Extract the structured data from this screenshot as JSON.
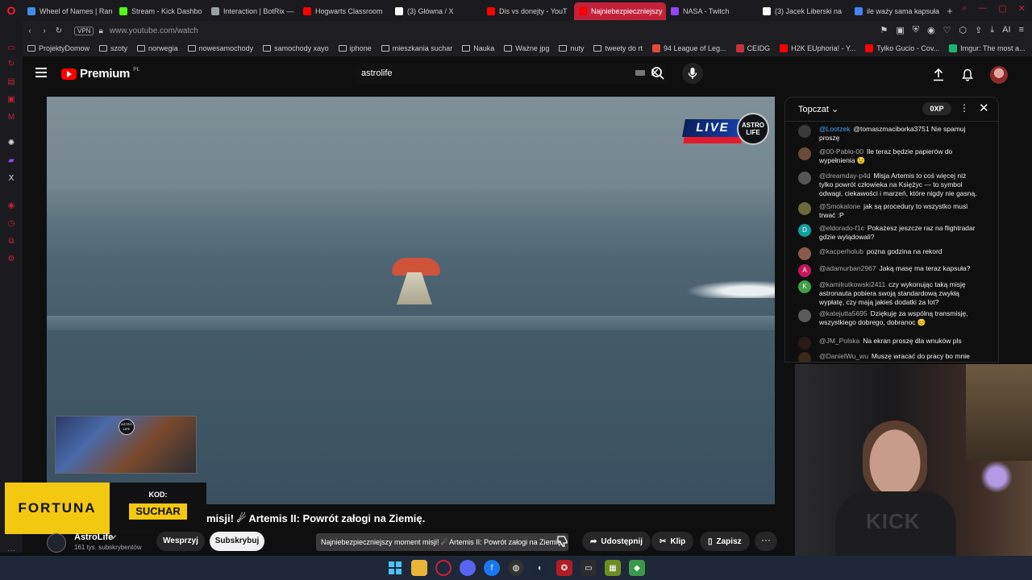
{
  "browser": {
    "tabs": [
      {
        "label": "Wheel of Names | Ran",
        "fav_color": "#3c8ee8",
        "active": false
      },
      {
        "label": "Stream - Kick Dashbo",
        "fav_color": "#53fc18",
        "active": false
      },
      {
        "label": "Interaction | BotRix —",
        "fav_color": "#9aa0a6",
        "active": false
      },
      {
        "label": "Hogwarts Classroom",
        "fav_color": "#ff0000",
        "active": false
      },
      {
        "label": "(3) Główna / X",
        "fav_color": "#ffffff",
        "active": false
      },
      {
        "label": "Dis vs donejty - YouT",
        "fav_color": "#ff0000",
        "active": false
      },
      {
        "label": "Najniebezpieczniejszy",
        "fav_color": "#ff0000",
        "active": true
      },
      {
        "label": "NASA - Twitch",
        "fav_color": "#9146ff",
        "active": false
      },
      {
        "label": "(3) Jacek Liberski na",
        "fav_color": "#ffffff",
        "active": false
      },
      {
        "label": "ile waży sama kapsuła",
        "fav_color": "#4285f4",
        "active": false
      }
    ],
    "new_tab_label": "+",
    "url": "www.youtube.com/watch",
    "vpn_label": "VPN",
    "ai_label": "AI",
    "bookmarks": [
      {
        "label": "ProjektyDomow",
        "type": "folder"
      },
      {
        "label": "szoty",
        "type": "folder"
      },
      {
        "label": "norwegia",
        "type": "folder"
      },
      {
        "label": "nowesamochody",
        "type": "folder"
      },
      {
        "label": "samochody xayo",
        "type": "folder"
      },
      {
        "label": "iphone",
        "type": "folder"
      },
      {
        "label": "mieszkania suchar",
        "type": "folder"
      },
      {
        "label": "Nauka",
        "type": "folder"
      },
      {
        "label": "Ważne jpg",
        "type": "folder"
      },
      {
        "label": "nuty",
        "type": "folder"
      },
      {
        "label": "tweety do rt",
        "type": "folder"
      },
      {
        "label": "94 League of Leg...",
        "type": "site",
        "fav_color": "#e04a3a"
      },
      {
        "label": "CEIDG",
        "type": "site",
        "fav_color": "#c8323c"
      },
      {
        "label": "H2K EUphoria! - Y...",
        "type": "site",
        "fav_color": "#ff0000"
      },
      {
        "label": "Tylko Gucio - Cov...",
        "type": "site",
        "fav_color": "#ff0000"
      },
      {
        "label": "Imgur: The most a...",
        "type": "site",
        "fav_color": "#1bb76e"
      }
    ]
  },
  "youtube": {
    "logo_text": "Premium",
    "logo_region": "PL",
    "search_value": "astrolife",
    "video": {
      "live_badge": "LIVE",
      "channel_badge": "ASTRO LIFE",
      "title": "misji! ☄ Artemis II: Powrót załogi na Ziemię.",
      "tooltip": "Najniebezpieczniejszy moment misji! ☄ Artemis II: Powrót załogi na Ziemię."
    },
    "channel": {
      "name": "AstroLife",
      "subscribers": "161 tys. subskrybentów",
      "support_label": "Wesprzyj",
      "subscribe_label": "Subskrybuj"
    },
    "actions": {
      "share_label": "Udostępnij",
      "clip_label": "Klip",
      "save_label": "Zapisz"
    },
    "ad": {
      "brand": "FORTUNA",
      "code_label": "KOD:",
      "code": "SUCHAR"
    },
    "chat": {
      "mode": "Topczat",
      "xp": "0XP",
      "messages": [
        {
          "author": "@Lootzek",
          "text": "@tomaszmaciborka3751 Nie spamuj proszę",
          "owner": true,
          "avatar_color": "#3a3a3a",
          "initial": ""
        },
        {
          "author": "@00-Pablo-00",
          "text": "Ile teraz będzie papierów do wypełnienia 😉",
          "owner": false,
          "avatar_color": "#6a4a3a",
          "initial": ""
        },
        {
          "author": "@dreamday-p4d",
          "text": "Misja Artemis to coś więcej niż tylko powrót człowieka na Księżyc — to symbol odwagi, ciekawości i marzeń, które nigdy nie gasną.",
          "owner": false,
          "avatar_color": "#555555",
          "initial": ""
        },
        {
          "author": "@Smokalone",
          "text": "jak są procedury to wszystko musi trwać :P",
          "owner": false,
          "avatar_color": "#6b6a3a",
          "initial": ""
        },
        {
          "author": "@eldorado-f1c",
          "text": "Pokażesz jeszcze raz na flightradar gdzie wylądowali?",
          "owner": false,
          "avatar_color": "#12a0a0",
          "initial": "D"
        },
        {
          "author": "@kacperholub",
          "text": "pozna godzina na rekord",
          "owner": false,
          "avatar_color": "#8a5a4a",
          "initial": ""
        },
        {
          "author": "@adamurban2967",
          "text": "Jaką masę ma teraz kapsuła?",
          "owner": false,
          "avatar_color": "#c2185b",
          "initial": "A"
        },
        {
          "author": "@kamilrutkowski2411",
          "text": "czy wykonując taką misję astronauta pobiera swoją standardową zwykłą wypłatę, czy mają jakieś dodatki za lot?",
          "owner": false,
          "avatar_color": "#43a047",
          "initial": "K"
        },
        {
          "author": "@katejutta5695",
          "text": "Dziękuję za wspólną transmisję, wszystkiego dobrego, dobranoc 😊",
          "owner": false,
          "avatar_color": "#5a5a5a",
          "initial": ""
        },
        {
          "author": "@JM_Polska",
          "text": "Na ekran proszę dla wnuków pls",
          "owner": false,
          "avatar_color": "#2a1a1a",
          "initial": ""
        },
        {
          "author": "@DanielWu_wu",
          "text": "Muszę wracać do pracy bo mnie",
          "owner": false,
          "avatar_color": "#3a2a1a",
          "initial": ""
        }
      ]
    }
  },
  "webcam": {
    "shirt_text": "KICK"
  }
}
